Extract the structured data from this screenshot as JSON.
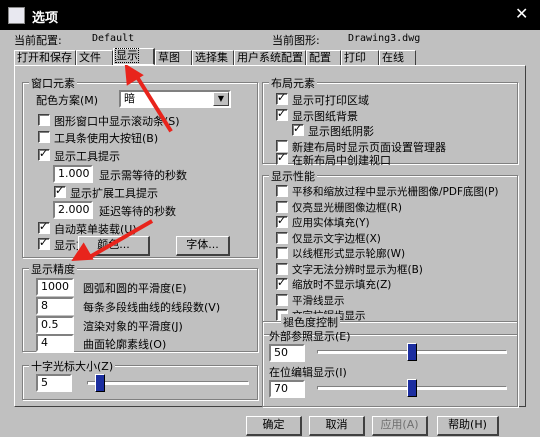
{
  "window": {
    "title": "选项",
    "close": "✕"
  },
  "header": {
    "profile_label": "当前配置:",
    "profile_value": "Default",
    "drawing_label": "当前图形:",
    "drawing_value": "Drawing3.dwg"
  },
  "tabs": [
    {
      "label": "打开和保存"
    },
    {
      "label": "文件"
    },
    {
      "label": "显示",
      "active": true
    },
    {
      "label": "草图"
    },
    {
      "label": "选择集"
    },
    {
      "label": "用户系统配置"
    },
    {
      "label": "配置"
    },
    {
      "label": "打印"
    },
    {
      "label": "在线"
    }
  ],
  "window_elements": {
    "title": "窗口元素",
    "color_scheme_label": "配色方案(M)",
    "color_scheme_value": "暗",
    "checks": [
      {
        "label": "图形窗口中显示滚动条(S)",
        "checked": false
      },
      {
        "label": "工具条使用大按钮(B)",
        "checked": false
      },
      {
        "label": "显示工具提示",
        "checked": true
      }
    ],
    "tooltip_delay_value": "1.000",
    "tooltip_delay_label": "显示需等待的秒数",
    "extended_tooltip_label": "显示扩展工具提示",
    "extended_tooltip_checked": true,
    "extended_delay_value": "2.000",
    "extended_delay_label": "延迟等待的秒数",
    "checks2": [
      {
        "label": "自动菜单装载(U)",
        "checked": true
      },
      {
        "label": "显示文件选项卡(T)",
        "checked": true
      }
    ],
    "colors_button": "颜色...",
    "fonts_button": "字体..."
  },
  "display_resolution": {
    "title": "显示精度",
    "rows": [
      {
        "value": "1000",
        "label": "圆弧和圆的平滑度(E)"
      },
      {
        "value": "8",
        "label": "每条多段线曲线的线段数(V)"
      },
      {
        "value": "0.5",
        "label": "渲染对象的平滑度(J)"
      },
      {
        "value": "4",
        "label": "曲面轮廓素线(O)"
      }
    ]
  },
  "crosshair": {
    "title": "十字光标大小(Z)",
    "value": "5",
    "level_percent": 5
  },
  "layout_elements": {
    "title": "布局元素",
    "items": [
      {
        "label": "显示可打印区域",
        "checked": true
      },
      {
        "label": "显示图纸背景",
        "checked": true
      },
      {
        "label": "显示图纸阴影",
        "checked": true
      },
      {
        "label": "新建布局时显示页面设置管理器",
        "checked": false
      },
      {
        "label": "在新布局中创建视口",
        "checked": true
      }
    ]
  },
  "display_performance": {
    "title": "显示性能",
    "items": [
      {
        "label": "平移和缩放过程中显示光栅图像/PDF底图(P)",
        "checked": false
      },
      {
        "label": "仅亮显光栅图像边框(R)",
        "checked": false
      },
      {
        "label": "应用实体填充(Y)",
        "checked": true
      },
      {
        "label": "仅显示文字边框(X)",
        "checked": false
      },
      {
        "label": "以线框形式显示轮廓(W)",
        "checked": false
      },
      {
        "label": "文字无法分辨时显示为框(B)",
        "checked": false
      },
      {
        "label": "缩放时不显示填充(Z)",
        "checked": true
      },
      {
        "label": "平滑线显示",
        "checked": false
      },
      {
        "label": "文字抗锯齿显示",
        "checked": false
      }
    ]
  },
  "fade_control": {
    "title": "褪色度控制",
    "xref_label": "外部参照显示(E)",
    "xref_value": "50",
    "xref_level_percent": 50,
    "inplace_label": "在位编辑显示(I)",
    "inplace_value": "70",
    "inplace_level_percent": 50
  },
  "footer": {
    "ok": "确定",
    "cancel": "取消",
    "apply": "应用(A)",
    "help": "帮助(H)"
  },
  "colors": {
    "annotation_arrow": "#e8241c",
    "thumb": "#1c2ea0",
    "face": "#c0c0c0"
  }
}
